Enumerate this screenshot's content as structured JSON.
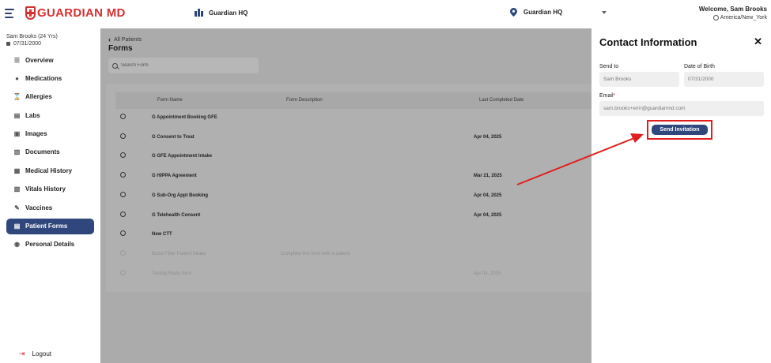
{
  "header": {
    "logo_text": "GUARDIAN MD",
    "org_name": "Guardian HQ",
    "location_name": "Guardian HQ",
    "welcome": "Welcome, Sam Brooks",
    "timezone": "America/New_York"
  },
  "patient": {
    "name_age": "Sam Brooks (24 Yrs)",
    "dob": "07/31/2000"
  },
  "sidebar": {
    "items": [
      {
        "label": "Overview",
        "icon": "list-icon"
      },
      {
        "label": "Medications",
        "icon": "pill-icon"
      },
      {
        "label": "Allergies",
        "icon": "hourglass-icon"
      },
      {
        "label": "Labs",
        "icon": "clipboard-icon"
      },
      {
        "label": "Images",
        "icon": "image-icon"
      },
      {
        "label": "Documents",
        "icon": "document-icon"
      },
      {
        "label": "Medical History",
        "icon": "history-icon"
      },
      {
        "label": "Vitals History",
        "icon": "vitals-icon"
      },
      {
        "label": "Vaccines",
        "icon": "syringe-icon"
      },
      {
        "label": "Patient Forms",
        "icon": "forms-icon",
        "active": true
      },
      {
        "label": "Personal Details",
        "icon": "person-icon"
      }
    ],
    "logout": "Logout"
  },
  "main": {
    "back_label": "All Patients",
    "title": "Forms",
    "search_placeholder": "Search Form",
    "columns": [
      "Form Name",
      "Form Description",
      "Last Completed Date"
    ],
    "rows": [
      {
        "name": "G Appointment Booking GFE",
        "description": "",
        "date": "",
        "disabled": false
      },
      {
        "name": "G Consent to Treat",
        "description": "",
        "date": "Apr 04, 2025",
        "disabled": false
      },
      {
        "name": "G GFE Appointment Intake",
        "description": "",
        "date": "",
        "disabled": false
      },
      {
        "name": "G HIPPA Agreement",
        "description": "",
        "date": "Mar 21, 2025",
        "disabled": false
      },
      {
        "name": "G Sub-Org Appt Booking",
        "description": "",
        "date": "Apr 04, 2025",
        "disabled": false
      },
      {
        "name": "G Telehealth Consent",
        "description": "",
        "date": "Apr 04, 2025",
        "disabled": false
      },
      {
        "name": "New CTT",
        "description": "",
        "date": "",
        "disabled": false
      },
      {
        "name": "Botox Filler Patient Intake",
        "description": "Complete this form with a patient",
        "date": "",
        "disabled": true
      },
      {
        "name": "Testing Radio form",
        "description": "",
        "date": "Apr 04, 2025",
        "disabled": true
      }
    ]
  },
  "panel": {
    "title": "Contact Information",
    "send_to_label": "Send to",
    "send_to_value": "Sam Brooks",
    "dob_label": "Date of Birth",
    "dob_value": "07/31/2000",
    "email_label": "Email",
    "email_required": "*",
    "email_value": "sam.brooks+emr@guardianmd.com",
    "send_button": "Send Invitation"
  },
  "colors": {
    "brand_red": "#d63030",
    "primary_navy": "#2f477c",
    "annotation_red": "#e21d1d"
  }
}
